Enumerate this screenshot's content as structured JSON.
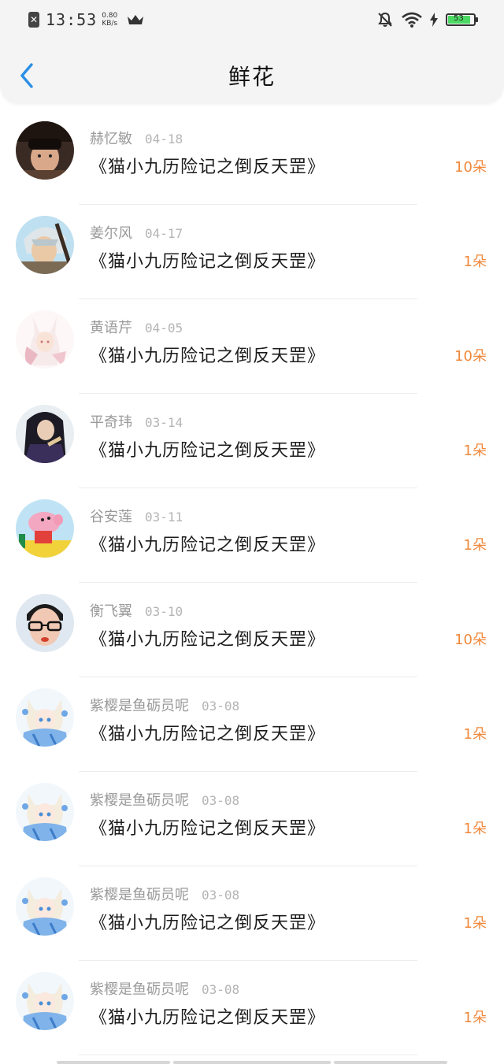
{
  "status_bar": {
    "time": "13:53",
    "net_speed_value": "0.80",
    "net_speed_unit": "KB/s",
    "battery_level": "53",
    "accent_color": "#4cd964"
  },
  "header": {
    "title": "鲜花",
    "back_icon": "chevron-left-icon",
    "back_color": "#2b8fe6"
  },
  "flowers": [
    {
      "user": "赫忆敏",
      "date": "04-18",
      "work": "《猫小九历险记之倒反天罡》",
      "count": "10朵",
      "avatar": "photo-dark"
    },
    {
      "user": "姜尔风",
      "date": "04-17",
      "work": "《猫小九历险记之倒反天罡》",
      "count": "1朵",
      "avatar": "anime-warrior"
    },
    {
      "user": "黄语芹",
      "date": "04-05",
      "work": "《猫小九历险记之倒反天罡》",
      "count": "10朵",
      "avatar": "anime-white-fox"
    },
    {
      "user": "平奇玮",
      "date": "03-14",
      "work": "《猫小九历险记之倒反天罡》",
      "count": "1朵",
      "avatar": "anime-dark-hair"
    },
    {
      "user": "谷安莲",
      "date": "03-11",
      "work": "《猫小九历险记之倒反天罡》",
      "count": "1朵",
      "avatar": "cartoon-pig"
    },
    {
      "user": "衡飞翼",
      "date": "03-10",
      "work": "《猫小九历险记之倒反天罡》",
      "count": "10朵",
      "avatar": "photo-glasses"
    },
    {
      "user": "紫樱是鱼砺员呢",
      "date": "03-08",
      "work": "《猫小九历险记之倒反天罡》",
      "count": "1朵",
      "avatar": "anime-catgirl"
    },
    {
      "user": "紫樱是鱼砺员呢",
      "date": "03-08",
      "work": "《猫小九历险记之倒反天罡》",
      "count": "1朵",
      "avatar": "anime-catgirl"
    },
    {
      "user": "紫樱是鱼砺员呢",
      "date": "03-08",
      "work": "《猫小九历险记之倒反天罡》",
      "count": "1朵",
      "avatar": "anime-catgirl"
    },
    {
      "user": "紫樱是鱼砺员呢",
      "date": "03-08",
      "work": "《猫小九历险记之倒反天罡》",
      "count": "1朵",
      "avatar": "anime-catgirl"
    }
  ],
  "colors": {
    "count": "#f0883b",
    "name": "#9a9a9a",
    "title": "#1c1c1c",
    "divider": "#ededed"
  }
}
